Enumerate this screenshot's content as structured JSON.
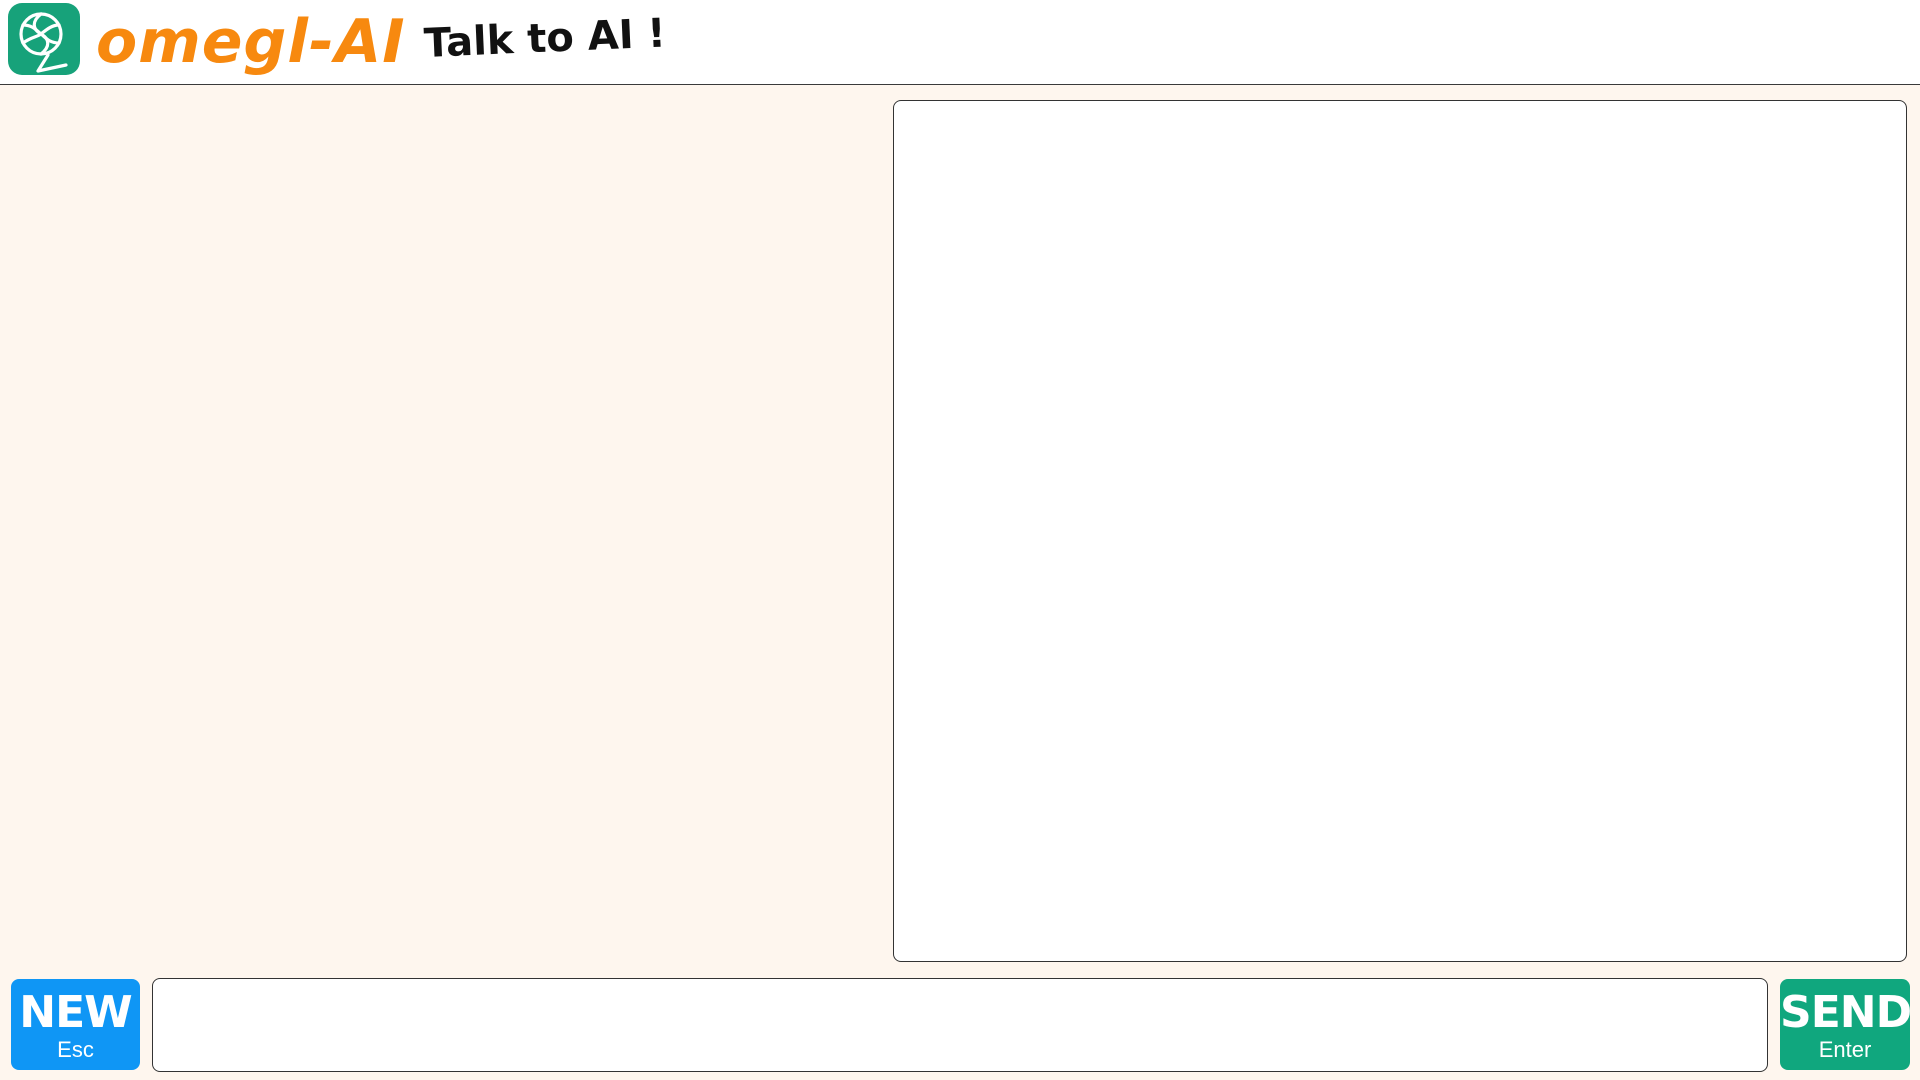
{
  "header": {
    "logo_text": "omegl-AI",
    "tagline": "Talk to AI !"
  },
  "controls": {
    "new_label": "NEW",
    "new_shortcut": "Esc",
    "send_label": "SEND",
    "send_shortcut": "Enter",
    "message_placeholder": ""
  },
  "colors": {
    "brand_orange": "#f7890f",
    "logo_green": "#17a27a",
    "new_button": "#0f96f5",
    "send_button": "#10a77e",
    "page_background": "#fef6ee"
  },
  "icons": {
    "logo": "openai-knot-icon"
  }
}
